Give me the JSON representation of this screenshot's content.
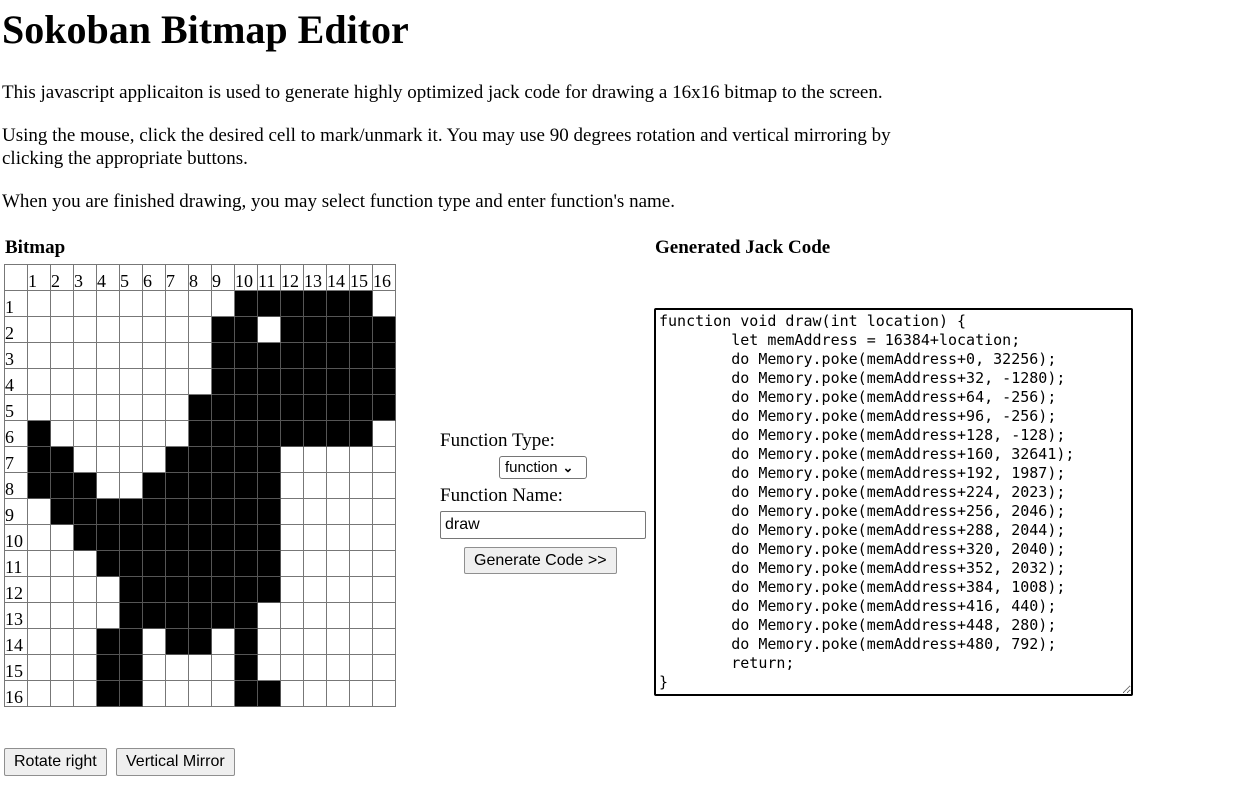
{
  "page": {
    "title": "Sokoban Bitmap Editor",
    "para1": "This javascript applicaiton is used to generate highly optimized jack code for drawing a 16x16 bitmap to the screen.",
    "para2": "Using the mouse, click the desired cell to mark/unmark it. You may use 90 degrees rotation and vertical mirroring by clicking the appropriate buttons.",
    "para3": "When you are finished drawing, you may select function type and enter function's name."
  },
  "bitmap": {
    "title": "Bitmap",
    "col_headers": [
      "1",
      "2",
      "3",
      "4",
      "5",
      "6",
      "7",
      "8",
      "9",
      "10",
      "11",
      "12",
      "13",
      "14",
      "15",
      "16"
    ],
    "row_headers": [
      "1",
      "2",
      "3",
      "4",
      "5",
      "6",
      "7",
      "8",
      "9",
      "10",
      "11",
      "12",
      "13",
      "14",
      "15",
      "16"
    ],
    "rows": [
      "0000000001111110",
      "0000000011011111",
      "0000000011111111",
      "0000000011111111",
      "0000000111111111",
      "1000000111111110",
      "1100001111100000",
      "1110011111100000",
      "0111111111100000",
      "0011111111100000",
      "0001111111100000",
      "0000111111100000",
      "0000111111000000",
      "0001101101000000",
      "0001100001000000",
      "0001100001100000"
    ],
    "rotate_label": "Rotate right",
    "mirror_label": "Vertical Mirror"
  },
  "controls": {
    "function_type_label": "Function Type:",
    "function_type_value": "function",
    "function_name_label": "Function Name:",
    "function_name_value": "draw",
    "generate_label": "Generate Code >>"
  },
  "code": {
    "title": "Generated Jack Code",
    "text": "function void draw(int location) {\n\tlet memAddress = 16384+location;\n\tdo Memory.poke(memAddress+0, 32256);\n\tdo Memory.poke(memAddress+32, -1280);\n\tdo Memory.poke(memAddress+64, -256);\n\tdo Memory.poke(memAddress+96, -256);\n\tdo Memory.poke(memAddress+128, -128);\n\tdo Memory.poke(memAddress+160, 32641);\n\tdo Memory.poke(memAddress+192, 1987);\n\tdo Memory.poke(memAddress+224, 2023);\n\tdo Memory.poke(memAddress+256, 2046);\n\tdo Memory.poke(memAddress+288, 2044);\n\tdo Memory.poke(memAddress+320, 2040);\n\tdo Memory.poke(memAddress+352, 2032);\n\tdo Memory.poke(memAddress+384, 1008);\n\tdo Memory.poke(memAddress+416, 440);\n\tdo Memory.poke(memAddress+448, 280);\n\tdo Memory.poke(memAddress+480, 792);\n\treturn;\n}"
  }
}
